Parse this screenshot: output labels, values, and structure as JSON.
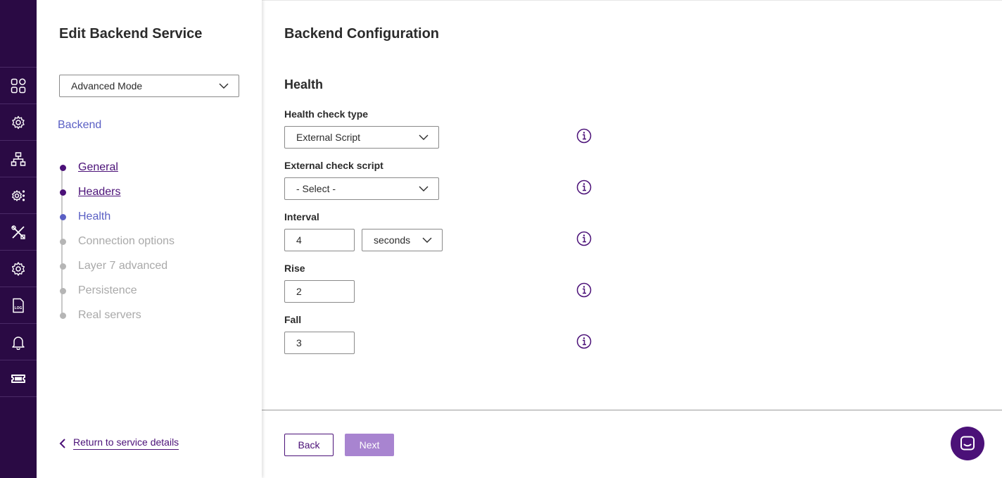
{
  "rail": {
    "items": [
      {
        "icon": "dashboard-icon"
      },
      {
        "icon": "services-gear-icon"
      },
      {
        "icon": "network-icon"
      },
      {
        "icon": "cluster-settings-icon"
      },
      {
        "icon": "tools-icon"
      },
      {
        "icon": "settings-gear-icon"
      },
      {
        "icon": "log-file-icon"
      },
      {
        "icon": "bell-icon"
      },
      {
        "icon": "ticket-icon"
      }
    ],
    "log_icon_text": "LOG"
  },
  "steps_panel": {
    "title": "Edit Backend Service",
    "mode_select": "Advanced Mode",
    "section_label": "Backend",
    "steps": [
      {
        "label": "General",
        "state": "done"
      },
      {
        "label": "Headers",
        "state": "done"
      },
      {
        "label": "Health",
        "state": "current"
      },
      {
        "label": "Connection options",
        "state": "todo"
      },
      {
        "label": "Layer 7 advanced",
        "state": "todo"
      },
      {
        "label": "Persistence",
        "state": "todo"
      },
      {
        "label": "Real servers",
        "state": "todo"
      }
    ],
    "return_link": "Return to service details"
  },
  "main": {
    "title": "Backend Configuration",
    "group_title": "Health",
    "fields": {
      "health_check_type": {
        "label": "Health check type",
        "value": "External Script"
      },
      "external_check_script": {
        "label": "External check script",
        "value": "- Select -"
      },
      "interval": {
        "label": "Interval",
        "value": "4",
        "unit": "seconds"
      },
      "rise": {
        "label": "Rise",
        "value": "2"
      },
      "fall": {
        "label": "Fall",
        "value": "3"
      }
    },
    "buttons": {
      "back": "Back",
      "next": "Next"
    }
  },
  "colors": {
    "rail_bg": "#2a0a44",
    "brand_purple": "#4b1178",
    "current_step_blue": "#5a5fc4",
    "disabled_next": "#a884d0",
    "inactive_gray": "#a9a9a9"
  }
}
